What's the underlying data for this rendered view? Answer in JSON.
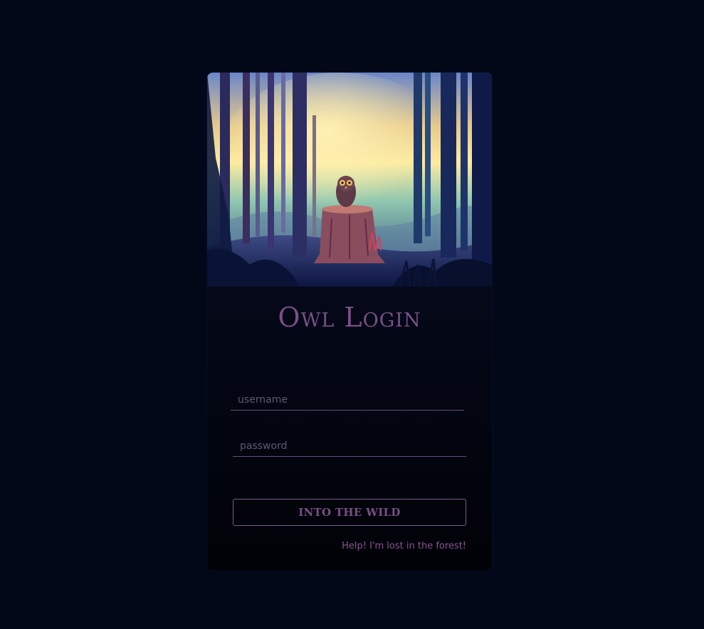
{
  "card": {
    "title": "Owl Login",
    "illustration": "owl-on-stump-forest-illustration"
  },
  "form": {
    "username_placeholder": "username",
    "username_value": "",
    "password_placeholder": "password",
    "password_value": "",
    "submit_label": "INTO THE WILD",
    "help_link": "Help! I'm lost in the forest!"
  },
  "colors": {
    "page_background": "#020818",
    "accent_purple": "#7a4f86",
    "link_purple": "#8a5491",
    "input_underline": "#6b4d80"
  }
}
